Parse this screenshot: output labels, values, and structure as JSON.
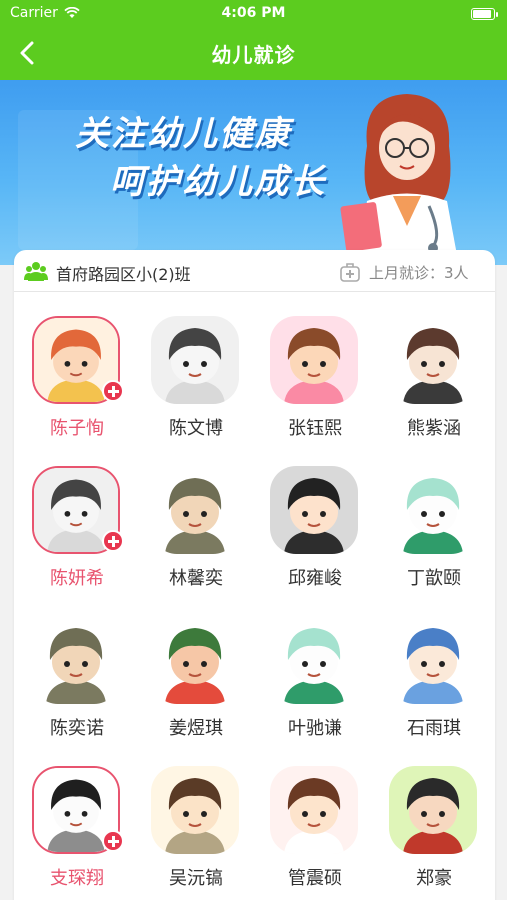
{
  "status_bar": {
    "carrier": "Carrier",
    "time": "4:06 PM"
  },
  "nav": {
    "title": "幼儿就诊",
    "back_icon": "chevron-left-icon"
  },
  "banner": {
    "line1": "关注幼儿健康",
    "line2": "呵护幼儿成长"
  },
  "class_info": {
    "name": "首府路园区小(2)班",
    "visits_label": "上月就诊：3人"
  },
  "colors": {
    "brand": "#5ccc1f",
    "sick": "#e8546f",
    "badge": "#e8364f"
  },
  "children": [
    {
      "name": "陈子恂",
      "sick": true,
      "palette": "orange"
    },
    {
      "name": "陈文博",
      "sick": false,
      "palette": "gray"
    },
    {
      "name": "张钰熙",
      "sick": false,
      "palette": "pink"
    },
    {
      "name": "熊紫涵",
      "sick": false,
      "palette": "white"
    },
    {
      "name": "陈妍希",
      "sick": true,
      "palette": "gray"
    },
    {
      "name": "林馨奕",
      "sick": false,
      "palette": "camo"
    },
    {
      "name": "邱雍峻",
      "sick": false,
      "palette": "silver"
    },
    {
      "name": "丁歆颐",
      "sick": false,
      "palette": "mint"
    },
    {
      "name": "陈奕诺",
      "sick": false,
      "palette": "camo"
    },
    {
      "name": "姜煜琪",
      "sick": false,
      "palette": "green"
    },
    {
      "name": "叶驰谦",
      "sick": false,
      "palette": "mint"
    },
    {
      "name": "石雨琪",
      "sick": false,
      "palette": "blue"
    },
    {
      "name": "支琛翔",
      "sick": true,
      "palette": "ink"
    },
    {
      "name": "吴沅镐",
      "sick": false,
      "palette": "brown"
    },
    {
      "name": "管震硕",
      "sick": false,
      "palette": "peach"
    },
    {
      "name": "郑豪",
      "sick": false,
      "palette": "lime"
    }
  ]
}
